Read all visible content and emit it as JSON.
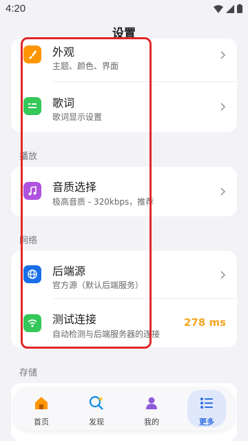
{
  "status": {
    "time": "4:20"
  },
  "header": {
    "title": "设置"
  },
  "appearance_card": {
    "items": [
      {
        "title": "外观",
        "subtitle": "主题、颜色、界面",
        "icon": "brush-icon",
        "color": "#ff9500"
      },
      {
        "title": "歌词",
        "subtitle": "歌词显示设置",
        "icon": "lyrics-icon",
        "color": "#34c759"
      }
    ]
  },
  "playback_section": {
    "label": "播放",
    "items": [
      {
        "title": "音质选择",
        "subtitle": "极高音质 - 320kbps，推荐",
        "icon": "music-note-icon",
        "color": "#af52de"
      }
    ]
  },
  "network_section": {
    "label": "网络",
    "items": [
      {
        "title": "后端源",
        "subtitle": "官方源（默认后端服务）",
        "icon": "globe-icon",
        "color": "#1a6fe8"
      },
      {
        "title": "测试连接",
        "subtitle": "自动检测与后端服务器的连接",
        "icon": "wifi-icon",
        "color": "#34c759",
        "value": "278 ms",
        "value_color": "#f5a623"
      }
    ]
  },
  "storage_section": {
    "label": "存储"
  },
  "bottom_nav": {
    "items": [
      {
        "label": "首页",
        "icon": "home-icon",
        "active": false
      },
      {
        "label": "发现",
        "icon": "discover-icon",
        "active": false
      },
      {
        "label": "我的",
        "icon": "profile-icon",
        "active": false
      },
      {
        "label": "更多",
        "icon": "more-list-icon",
        "active": true
      }
    ]
  },
  "annotation": {
    "color": "#e0262a"
  }
}
